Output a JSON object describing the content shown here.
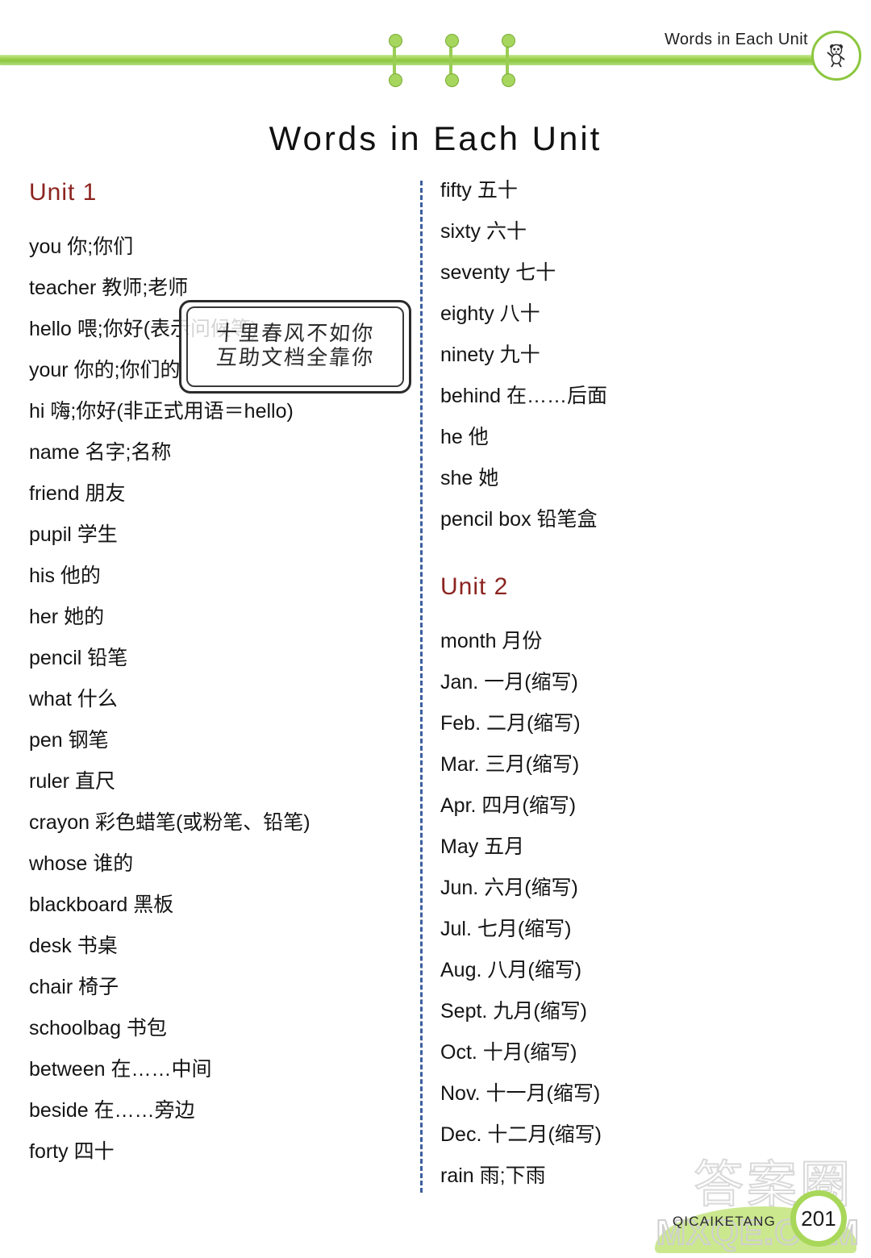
{
  "header": {
    "running_head": "Words in Each Unit",
    "badge_icon": "panda-mascot-icon",
    "rule_color": "#8cc63f"
  },
  "page": {
    "title": "Words in Each Unit",
    "accent_color": "#8c2420",
    "divider_color": "#3c5f9e"
  },
  "left_column": {
    "unit_heading": "Unit 1",
    "entries": [
      "you 你;你们",
      "teacher 教师;老师",
      "hello 喂;你好(表示问候等)",
      "your 你的;你们的",
      "hi 嗨;你好(非正式用语＝hello)",
      "name 名字;名称",
      "friend 朋友",
      "pupil 学生",
      "his 他的",
      "her 她的",
      "pencil 铅笔",
      "what 什么",
      "pen 钢笔",
      "ruler 直尺",
      "crayon 彩色蜡笔(或粉笔、铅笔)",
      "whose 谁的",
      "blackboard 黑板",
      "desk 书桌",
      "chair 椅子",
      "schoolbag 书包",
      "between 在……中间",
      "beside 在……旁边",
      "forty 四十"
    ]
  },
  "right_column": {
    "continued_entries": [
      "fifty 五十",
      "sixty 六十",
      "seventy 七十",
      "eighty 八十",
      "ninety 九十",
      "behind 在……后面",
      "he 他",
      "she 她",
      "pencil box 铅笔盒"
    ],
    "unit_heading": "Unit 2",
    "entries": [
      "month 月份",
      "Jan. 一月(缩写)",
      "Feb. 二月(缩写)",
      "Mar. 三月(缩写)",
      "Apr. 四月(缩写)",
      "May 五月",
      "Jun. 六月(缩写)",
      "Jul. 七月(缩写)",
      "Aug. 八月(缩写)",
      "Sept. 九月(缩写)",
      "Oct. 十月(缩写)",
      "Nov. 十一月(缩写)",
      "Dec. 十二月(缩写)",
      "rain 雨;下雨"
    ]
  },
  "stamp_watermark": {
    "line1": "十里春风不如你",
    "line2": "互助文档全靠你"
  },
  "footer": {
    "brand": "QICAIKETANG",
    "page_number": "201",
    "watermark_cn": "答案圈",
    "watermark_domain": "MXQE.COM"
  }
}
